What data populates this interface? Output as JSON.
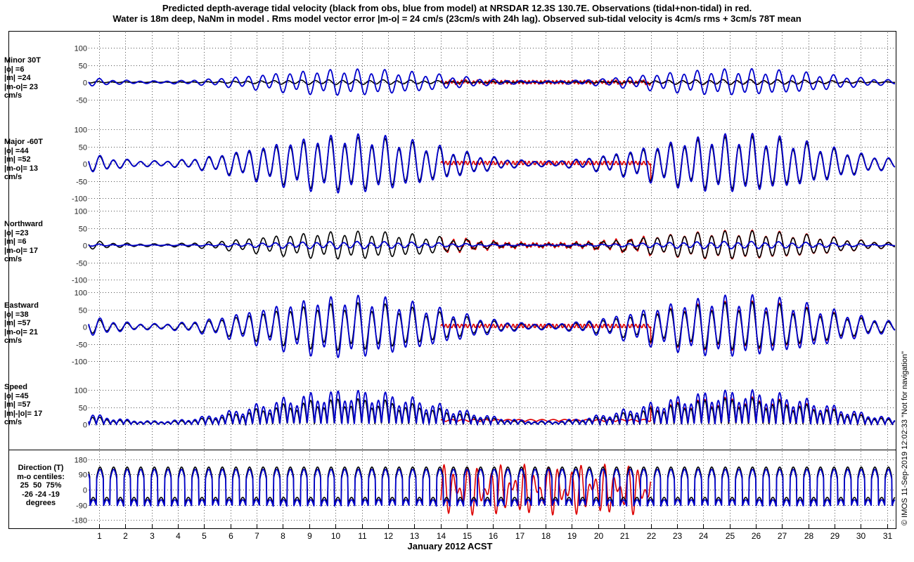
{
  "title": {
    "line1": "Predicted depth-average tidal velocity (black from obs, blue from model) at NRSDAR 12.3S 130.7E. Observations (tidal+non-tidal) in red.",
    "line2": "Water is 18m deep, NaNm in model . Rms model vector error |m-o| = 24 cm/s (23cm/s with 24h lag). Observed sub-tidal velocity is 4cm/s rms + 3cm/s 78T mean"
  },
  "xlabel": "January 2012 ACST",
  "sidenote": "© IMOS 11-Sep-2019 12:02:33  \"Not for navigation\"",
  "colors": {
    "obs_tidal": "#000000",
    "model": "#0000cc",
    "observations": "#dd0000",
    "grid": "#555555"
  },
  "chart_data": {
    "type": "line",
    "x": {
      "label": "January 2012 ACST",
      "range": [
        0.6,
        31.3
      ],
      "ticks": [
        "1",
        "2",
        "3",
        "4",
        "5",
        "6",
        "7",
        "8",
        "9",
        "10",
        "11",
        "12",
        "13",
        "14",
        "15",
        "16",
        "17",
        "18",
        "19",
        "20",
        "21",
        "22",
        "23",
        "24",
        "25",
        "26",
        "27",
        "28",
        "29",
        "30",
        "31"
      ]
    },
    "series_names": [
      "obs (tidal)",
      "model",
      "observations"
    ],
    "observations_span_days": [
      14.0,
      22.0
    ],
    "panels": [
      {
        "name": "Minor 30T",
        "label_lines": [
          "Minor 30T",
          "|o| =6",
          "|m| =24",
          "|m-o|= 23",
          "cm/s"
        ],
        "ylim": [
          -50,
          100
        ],
        "yticks": [
          "100",
          "50",
          "0",
          "-50"
        ],
        "obs_amplitude_cm_s": [
          3,
          10
        ],
        "model_amplitude_cm_s": [
          15,
          45
        ]
      },
      {
        "name": "Major -60T",
        "label_lines": [
          "Major -60T",
          "|o| =44",
          "|m| =52",
          "|m-o|= 13",
          "cm/s"
        ],
        "ylim": [
          -100,
          100
        ],
        "yticks": [
          "100",
          "50",
          "0",
          "-50",
          "-100"
        ],
        "obs_amplitude_cm_s": [
          20,
          105
        ],
        "model_amplitude_cm_s": [
          22,
          110
        ]
      },
      {
        "name": "Northward",
        "label_lines": [
          "Northward",
          "|o| =23",
          "|m| =6",
          "|m-o|= 17",
          "cm/s"
        ],
        "ylim": [
          -100,
          100
        ],
        "yticks": [
          "100",
          "50",
          "0",
          "-50",
          "-100"
        ],
        "obs_amplitude_cm_s": [
          8,
          55
        ],
        "model_amplitude_cm_s": [
          3,
          18
        ]
      },
      {
        "name": "Eastward",
        "label_lines": [
          "Eastward",
          "|o| =38",
          "|m| =57",
          "|m-o|= 21",
          "cm/s"
        ],
        "ylim": [
          -100,
          100
        ],
        "yticks": [
          "100",
          "50",
          "0",
          "-50",
          "-100"
        ],
        "obs_amplitude_cm_s": [
          25,
          100
        ],
        "model_amplitude_cm_s": [
          28,
          115
        ]
      },
      {
        "name": "Speed",
        "label_lines": [
          "Speed",
          "|o| =45",
          "|m| =57",
          "|m|-|o|= 17",
          "cm/s"
        ],
        "ylim": [
          0,
          110
        ],
        "yticks": [
          "100",
          "50",
          "0"
        ],
        "obs_range_cm_s": [
          0,
          100
        ],
        "model_range_cm_s": [
          0,
          120
        ]
      },
      {
        "name": "Direction (T)",
        "label_lines": [
          "Direction (T)",
          "m-o centiles:",
          "25  50  75%",
          "-26 -24 -19",
          "degrees"
        ],
        "ylim": [
          -180,
          180
        ],
        "yticks": [
          "180",
          "90",
          "0",
          "-90",
          "-180"
        ],
        "flood_direction_deg": 120,
        "ebb_direction_deg": -60
      }
    ]
  }
}
